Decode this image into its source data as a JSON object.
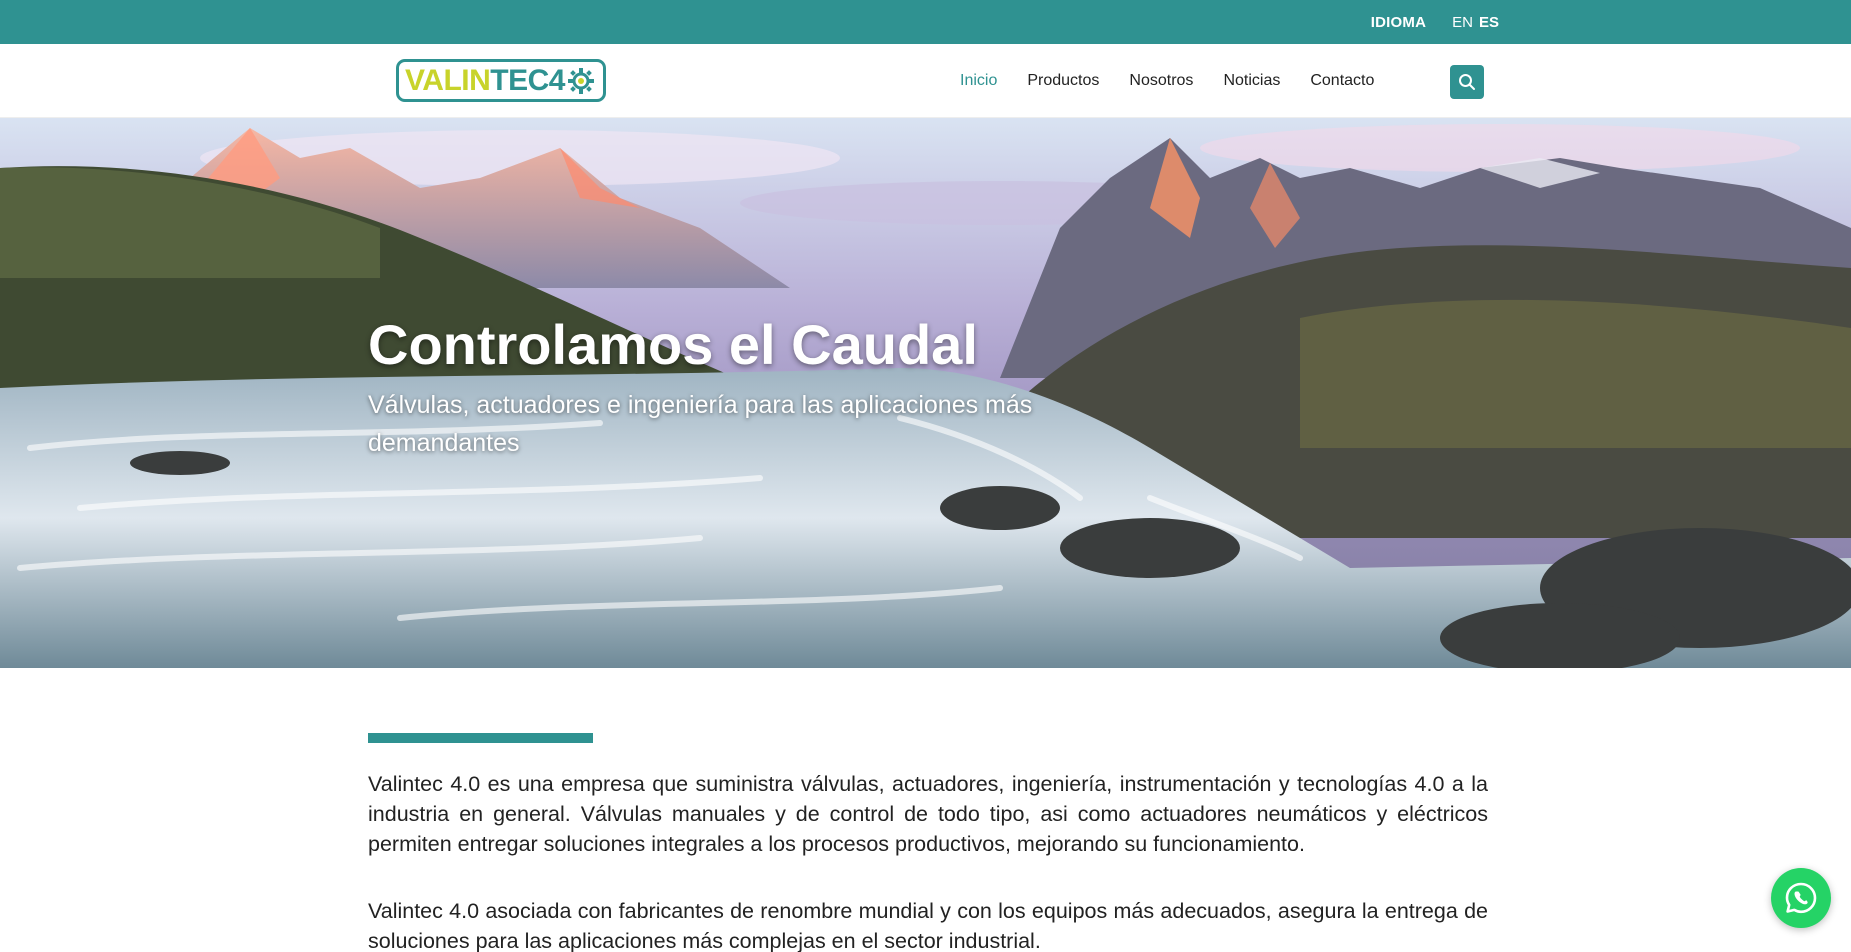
{
  "topbar": {
    "language_label": "IDIOMA",
    "languages": [
      {
        "code": "EN",
        "active": false
      },
      {
        "code": "ES",
        "active": true
      }
    ]
  },
  "header": {
    "logo": {
      "part_a": "VALIN",
      "part_b": "TEC4"
    },
    "nav": [
      {
        "label": "Inicio",
        "active": true
      },
      {
        "label": "Productos",
        "active": false
      },
      {
        "label": "Nosotros",
        "active": false
      },
      {
        "label": "Noticias",
        "active": false
      },
      {
        "label": "Contacto",
        "active": false
      }
    ],
    "search_icon": "search-icon"
  },
  "hero": {
    "title": "Controlamos el Caudal",
    "subtitle": "Válvulas, actuadores e ingeniería para las aplicaciones más demandantes"
  },
  "content": {
    "paragraph_1": "Valintec 4.0 es una empresa que suministra válvulas, actuadores, ingeniería, instrumentación y tecnologías 4.0 a la industria en general. Válvulas manuales y de control de todo tipo, asi como actuadores neumáticos y eléctricos permiten entregar soluciones integrales a los procesos productivos, mejorando su funcionamiento.",
    "paragraph_2": "Valintec 4.0 asociada con fabricantes de renombre mundial y con los equipos más adecuados, asegura la entrega de soluciones para las aplicaciones más complejas en el sector industrial."
  },
  "floating": {
    "icon": "whatsapp-icon"
  },
  "colors": {
    "accent": "#2f9291",
    "logo_yellow": "#c8d32a",
    "whatsapp": "#25d366"
  }
}
